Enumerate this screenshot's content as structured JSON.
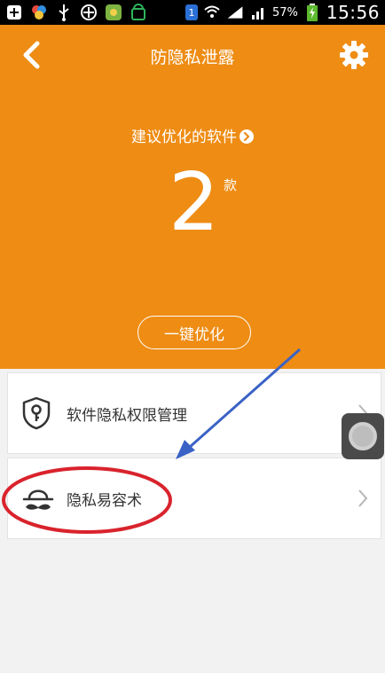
{
  "status_bar": {
    "notification_badge": "1",
    "battery_percent": "57%",
    "time": "15:56"
  },
  "header": {
    "title": "防隐私泄露"
  },
  "hero": {
    "label": "建议优化的软件",
    "count": "2",
    "unit": "款",
    "optimize_button": "一键优化"
  },
  "list": {
    "items": [
      {
        "label": "软件隐私权限管理",
        "icon": "shield-key-icon"
      },
      {
        "label": "隐私易容术",
        "icon": "hat-mustache-icon"
      }
    ]
  },
  "colors": {
    "accent": "#ee8c14",
    "annotation_red": "#d9232d",
    "annotation_blue": "#3a62c6"
  }
}
